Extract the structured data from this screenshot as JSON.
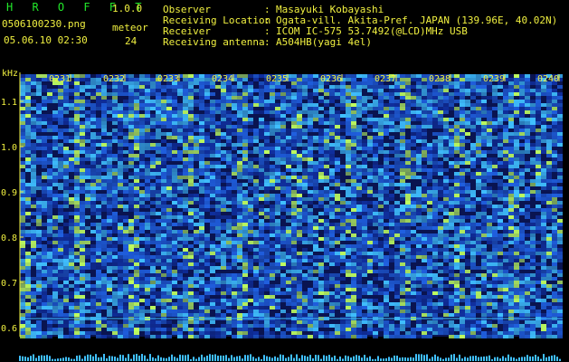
{
  "header": {
    "app_name": "H R O F F T",
    "version": "1.0.0",
    "filename": "0506100230.png",
    "meteor_label": "meteor",
    "datetime": "05.06.10 02:30",
    "meteor_count": "24"
  },
  "info": [
    {
      "label": "Observer",
      "value": "Masayuki Kobayashi"
    },
    {
      "label": "Receiving Location",
      "value": "Ogata-vill. Akita-Pref. JAPAN (139.96E, 40.02N)"
    },
    {
      "label": "Receiver",
      "value": "ICOM IC-575 53.7492(@LCD)MHz USB"
    },
    {
      "label": "Receiving antenna",
      "value": "A504HB(yagi 4el)"
    }
  ],
  "colon": ":",
  "chart_data": {
    "type": "heatmap",
    "ylabel": "kHz",
    "time_labels": [
      "0231",
      "0232",
      "0233",
      "0234",
      "0235",
      "0236",
      "0237",
      "0238",
      "0239",
      "0240"
    ],
    "y_ticks": [
      {
        "value": 1.1,
        "label": "1.1"
      },
      {
        "value": 1.0,
        "label": "1.0"
      },
      {
        "value": 0.9,
        "label": "0.9"
      },
      {
        "value": 0.8,
        "label": "0.8"
      },
      {
        "value": 0.7,
        "label": "0.7"
      },
      {
        "value": 0.6,
        "label": "0.6"
      }
    ],
    "ylim": [
      0.58,
      1.16
    ],
    "colors": {
      "background": "#0a1450",
      "low": "#1030a0",
      "mid": "#2060e0",
      "high": "#40c0ff",
      "peak": "#c0ff60",
      "axis": "#f0f040"
    }
  }
}
